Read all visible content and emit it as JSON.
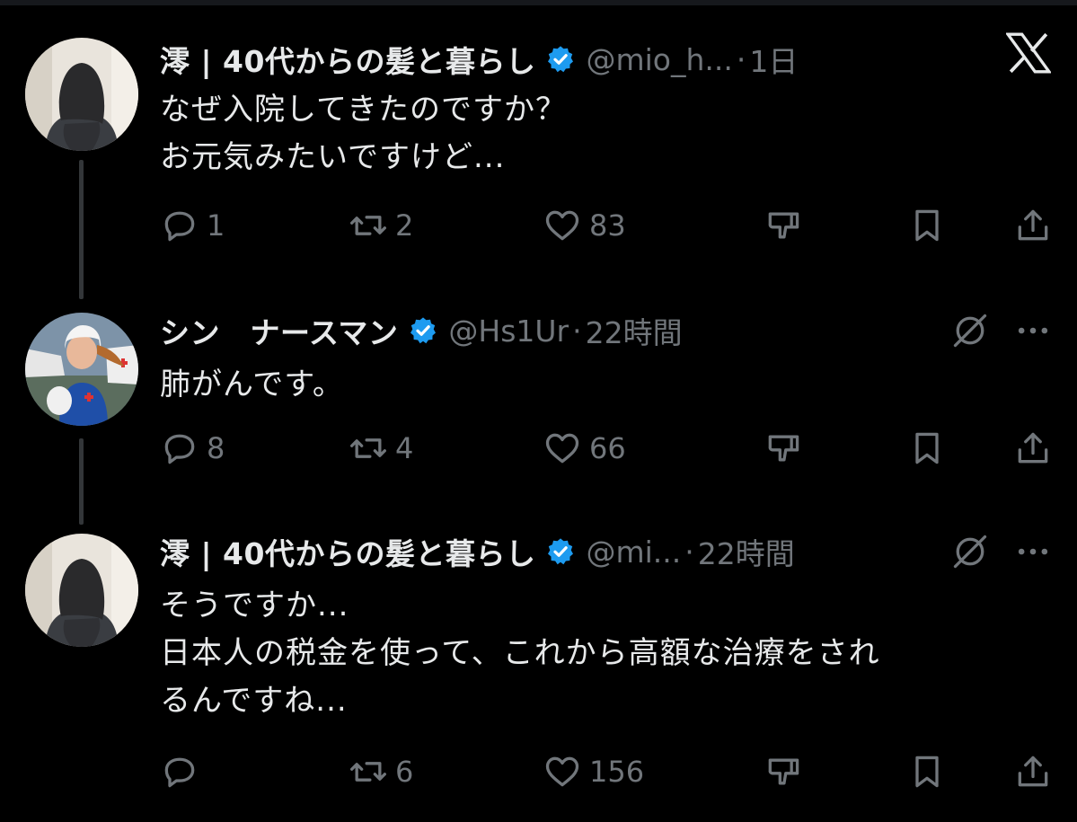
{
  "brand": {
    "logo_icon": "x-logo-icon"
  },
  "colors": {
    "background": "#000000",
    "text": "#e7e9ea",
    "muted": "#71767b",
    "verified": "#1d9bf0"
  },
  "tweets": [
    {
      "name": "澪 | 40代からの髪と暮らし",
      "handle": "@mio_h...",
      "sep": "·",
      "time": "1日",
      "lines": [
        "なぜ入院してきたのですか？",
        "お元気みたいですけど..."
      ],
      "actions": {
        "reply": "1",
        "retweet": "2",
        "like": "83"
      }
    },
    {
      "name": "シン　ナースマン",
      "handle": "@Hs1Ur",
      "sep": "·",
      "time": "22時間",
      "lines": [
        "肺がんです。"
      ],
      "actions": {
        "reply": "8",
        "retweet": "4",
        "like": "66"
      }
    },
    {
      "name": "澪 | 40代からの髪と暮らし",
      "handle": "@mi...",
      "sep": "·",
      "time": "22時間",
      "lines": [
        "そうですか...",
        "日本人の税金を使って、これから高額な治療をされ",
        "るんですね..."
      ],
      "actions": {
        "reply": "",
        "retweet": "6",
        "like": "156"
      }
    }
  ]
}
